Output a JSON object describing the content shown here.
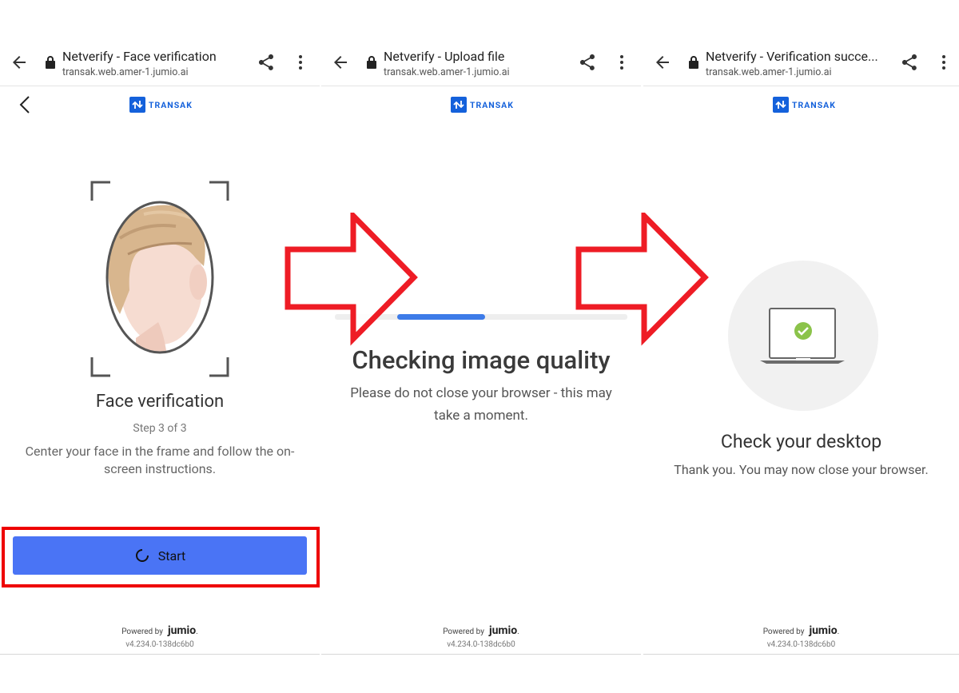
{
  "panels": [
    {
      "tab_title": "Netverify - Face verification",
      "tab_url": "transak.web.amer-1.jumio.ai",
      "heading": "Face verification",
      "step": "Step 3 of 3",
      "instruction_line1": "Center your face in the frame and follow the on-",
      "instruction_line2": "screen instructions.",
      "button_label": "Start"
    },
    {
      "tab_title": "Netverify - Upload file",
      "tab_url": "transak.web.amer-1.jumio.ai",
      "heading": "Checking image quality",
      "message_line1": "Please do not close your browser - this may",
      "message_line2": "take a moment.",
      "progress": 0.3
    },
    {
      "tab_title": "Netverify - Verification succe...",
      "tab_url": "transak.web.amer-1.jumio.ai",
      "heading": "Check your desktop",
      "message": "Thank you. You may now close your browser."
    }
  ],
  "brand": {
    "logo_text": "TRANSAK",
    "powered_by": "Powered by",
    "provider": "jumio",
    "provider_dot": ".",
    "version": "v4.234.0-138dc6b0"
  },
  "colors": {
    "accent": "#4a74f5",
    "brand_blue": "#1461db",
    "annotation_red": "#ee1c25",
    "success_green": "#8bc34a"
  },
  "icons": [
    "arrow-back-icon",
    "lock-icon",
    "share-icon",
    "more-vert-icon",
    "chevron-left-icon",
    "spinner-icon",
    "laptop-check-icon",
    "face-illustration",
    "flow-arrow"
  ]
}
